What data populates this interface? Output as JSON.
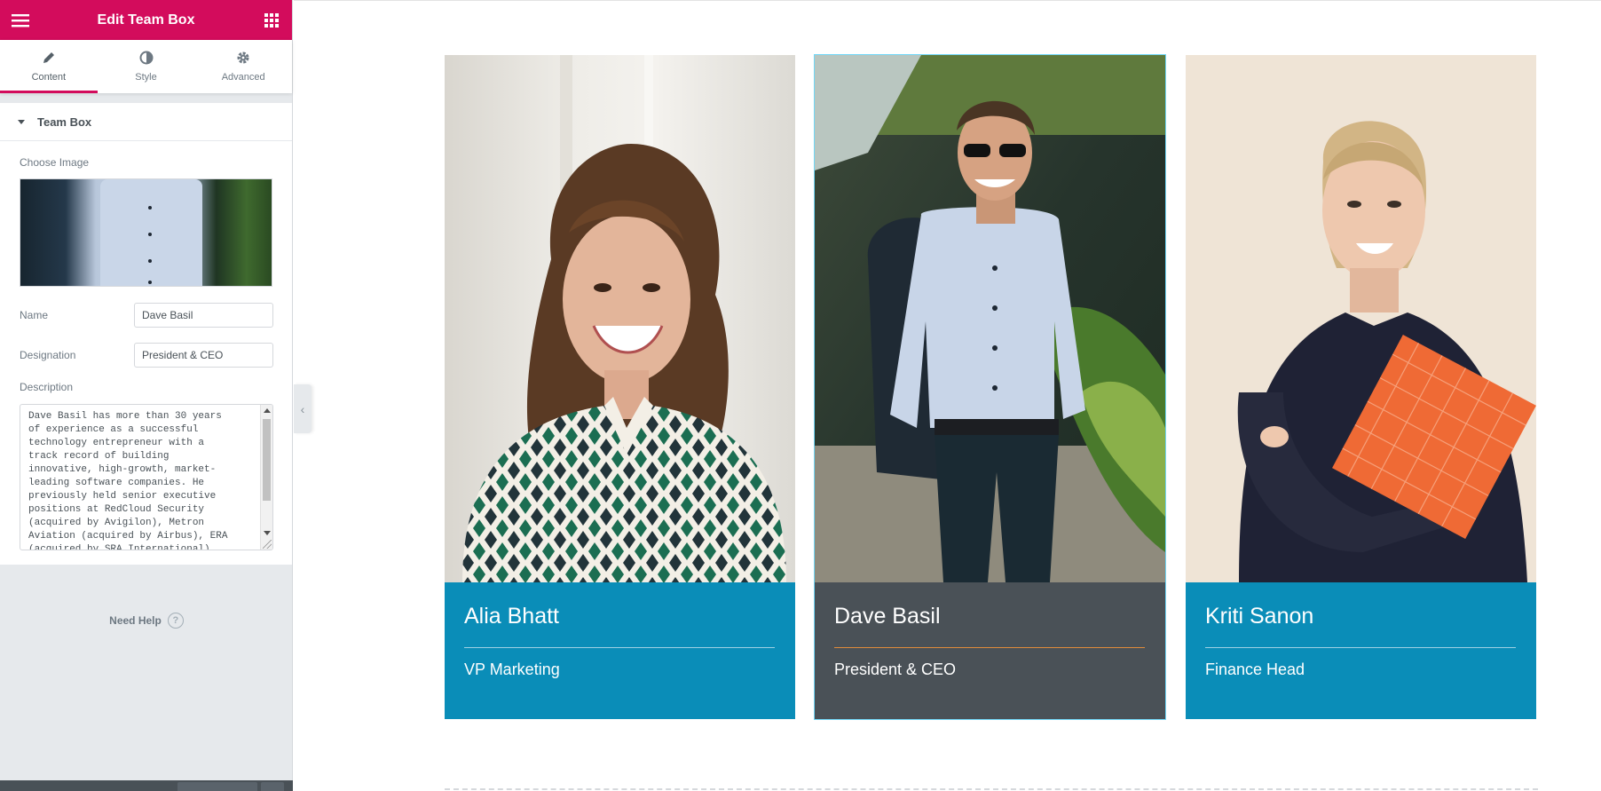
{
  "panel": {
    "title": "Edit Team Box",
    "tabs": [
      {
        "label": "Content",
        "icon": "pencil-icon"
      },
      {
        "label": "Style",
        "icon": "half-circle-icon"
      },
      {
        "label": "Advanced",
        "icon": "gear-icon"
      }
    ],
    "section_title": "Team Box",
    "choose_image_label": "Choose Image",
    "name_label": "Name",
    "name_value": "Dave Basil",
    "designation_label": "Designation",
    "designation_value": "President & CEO",
    "description_label": "Description",
    "description_value": "Dave Basil has more than 30 years\nof experience as a successful\ntechnology entrepreneur with a\ntrack record of building\ninnovative, high-growth, market-\nleading software companies. He\npreviously held senior executive\npositions at RedCloud Security\n(acquired by Avigilon), Metron\nAviation (acquired by Airbus), ERA\n(acquired by SRA International)",
    "need_help": "Need Help",
    "accent_color": "#d30c5c"
  },
  "team": [
    {
      "name": "Alia Bhatt",
      "role": "VP Marketing"
    },
    {
      "name": "Dave Basil",
      "role": "President & CEO"
    },
    {
      "name": "Kriti Sanon",
      "role": "Finance Head"
    }
  ],
  "colors": {
    "card_info": "#0a8db8",
    "card_active_info": "#4a5157",
    "active_rule": "#e08b3b"
  }
}
